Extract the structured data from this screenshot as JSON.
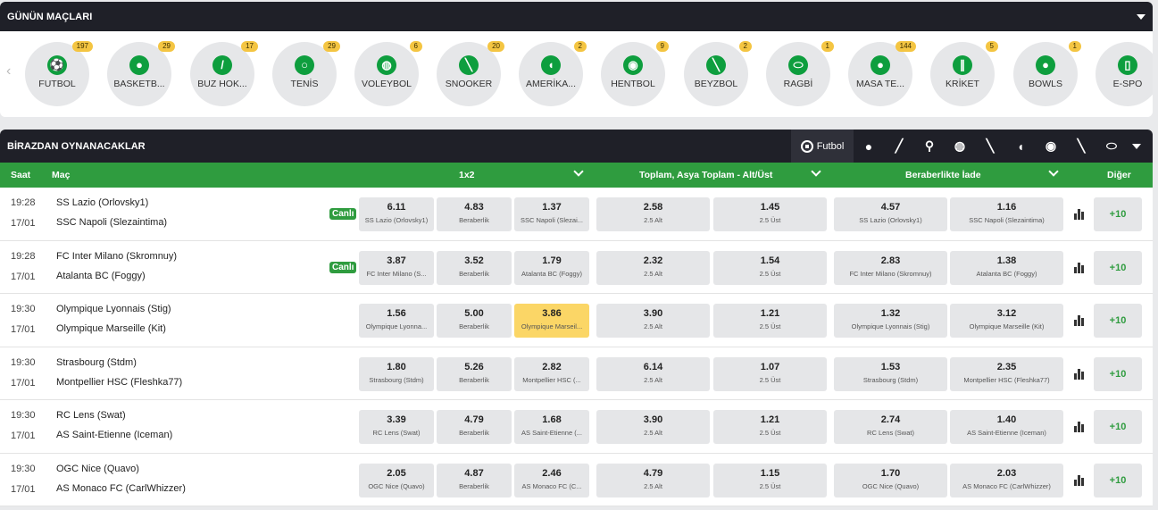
{
  "todays_matches": {
    "title": "GÜNÜN MAÇLARI",
    "sports": [
      {
        "name": "FUTBOL",
        "count": "197",
        "icon": "soccer-ball-icon",
        "glyph": "⚽"
      },
      {
        "name": "BASKETB...",
        "count": "29",
        "icon": "basketball-icon",
        "glyph": "●"
      },
      {
        "name": "BUZ HOK...",
        "count": "17",
        "icon": "ice-hockey-icon",
        "glyph": "/"
      },
      {
        "name": "TENİS",
        "count": "29",
        "icon": "tennis-icon",
        "glyph": "○"
      },
      {
        "name": "VOLEYBOL",
        "count": "6",
        "icon": "volleyball-icon",
        "glyph": "◍"
      },
      {
        "name": "SNOOKER",
        "count": "20",
        "icon": "snooker-icon",
        "glyph": "╲"
      },
      {
        "name": "AMERİKA...",
        "count": "2",
        "icon": "american-football-helmet-icon",
        "glyph": "◖"
      },
      {
        "name": "HENTBOL",
        "count": "9",
        "icon": "handball-icon",
        "glyph": "◉"
      },
      {
        "name": "BEYZBOL",
        "count": "2",
        "icon": "baseball-bat-icon",
        "glyph": "╲"
      },
      {
        "name": "RAGBİ",
        "count": "1",
        "icon": "rugby-ball-icon",
        "glyph": "⬭"
      },
      {
        "name": "MASA TE...",
        "count": "144",
        "icon": "table-tennis-icon",
        "glyph": "●"
      },
      {
        "name": "KRİKET",
        "count": "5",
        "icon": "cricket-icon",
        "glyph": "∥"
      },
      {
        "name": "BOWLS",
        "count": "1",
        "icon": "bowls-icon",
        "glyph": "●"
      },
      {
        "name": "E-SPO",
        "count": "",
        "icon": "esports-icon",
        "glyph": "▯"
      }
    ]
  },
  "upcoming": {
    "title": "BİRAZDAN OYNANACAKLAR",
    "active_filter": "Futbol",
    "filter_icons": [
      "basketball-icon",
      "ice-hockey-icon",
      "tennis-icon",
      "volleyball-icon",
      "snooker-icon",
      "american-football-helmet-icon",
      "handball-icon",
      "baseball-bat-icon",
      "rugby-ball-icon"
    ],
    "headers": {
      "time": "Saat",
      "match": "Maç",
      "market1": "1x2",
      "market2": "Toplam, Asya Toplam - Alt/Üst",
      "market3": "Beraberlikte İade",
      "other": "Diğer"
    },
    "rows": [
      {
        "time": "19:28",
        "date": "17/01",
        "home": "SS Lazio (Orlovsky1)",
        "away": "SSC Napoli (Slezaintima)",
        "live": "Canlı",
        "odds": [
          {
            "v": "6.11",
            "l": "SS Lazio (Orlovsky1)"
          },
          {
            "v": "4.83",
            "l": "Beraberlik"
          },
          {
            "v": "1.37",
            "l": "SSC Napoli (Slezai..."
          },
          {
            "v": "2.58",
            "l": "2.5 Alt"
          },
          {
            "v": "1.45",
            "l": "2.5 Üst"
          },
          {
            "v": "4.57",
            "l": "SS Lazio (Orlovsky1)"
          },
          {
            "v": "1.16",
            "l": "SSC Napoli (Slezaintima)"
          }
        ],
        "more": "+10",
        "highlight": -1
      },
      {
        "time": "19:28",
        "date": "17/01",
        "home": "FC Inter Milano (Skromnuy)",
        "away": "Atalanta BC (Foggy)",
        "live": "Canlı",
        "odds": [
          {
            "v": "3.87",
            "l": "FC Inter Milano (S..."
          },
          {
            "v": "3.52",
            "l": "Beraberlik"
          },
          {
            "v": "1.79",
            "l": "Atalanta BC (Foggy)"
          },
          {
            "v": "2.32",
            "l": "2.5 Alt"
          },
          {
            "v": "1.54",
            "l": "2.5 Üst"
          },
          {
            "v": "2.83",
            "l": "FC Inter Milano (Skromnuy)"
          },
          {
            "v": "1.38",
            "l": "Atalanta BC (Foggy)"
          }
        ],
        "more": "+10",
        "highlight": -1
      },
      {
        "time": "19:30",
        "date": "17/01",
        "home": "Olympique Lyonnais (Stig)",
        "away": "Olympique Marseille (Kit)",
        "live": "",
        "odds": [
          {
            "v": "1.56",
            "l": "Olympique Lyonna..."
          },
          {
            "v": "5.00",
            "l": "Beraberlik"
          },
          {
            "v": "3.86",
            "l": "Olympique Marseil..."
          },
          {
            "v": "3.90",
            "l": "2.5 Alt"
          },
          {
            "v": "1.21",
            "l": "2.5 Üst"
          },
          {
            "v": "1.32",
            "l": "Olympique Lyonnais (Stig)"
          },
          {
            "v": "3.12",
            "l": "Olympique Marseille (Kit)"
          }
        ],
        "more": "+10",
        "highlight": 2
      },
      {
        "time": "19:30",
        "date": "17/01",
        "home": "Strasbourg (Stdm)",
        "away": "Montpellier HSC (Fleshka77)",
        "live": "",
        "odds": [
          {
            "v": "1.80",
            "l": "Strasbourg (Stdm)"
          },
          {
            "v": "5.26",
            "l": "Beraberlik"
          },
          {
            "v": "2.82",
            "l": "Montpellier HSC (..."
          },
          {
            "v": "6.14",
            "l": "2.5 Alt"
          },
          {
            "v": "1.07",
            "l": "2.5 Üst"
          },
          {
            "v": "1.53",
            "l": "Strasbourg (Stdm)"
          },
          {
            "v": "2.35",
            "l": "Montpellier HSC (Fleshka77)"
          }
        ],
        "more": "+10",
        "highlight": -1
      },
      {
        "time": "19:30",
        "date": "17/01",
        "home": "RC Lens (Swat)",
        "away": "AS Saint-Etienne (Iceman)",
        "live": "",
        "odds": [
          {
            "v": "3.39",
            "l": "RC Lens (Swat)"
          },
          {
            "v": "4.79",
            "l": "Beraberlik"
          },
          {
            "v": "1.68",
            "l": "AS Saint-Etienne (..."
          },
          {
            "v": "3.90",
            "l": "2.5 Alt"
          },
          {
            "v": "1.21",
            "l": "2.5 Üst"
          },
          {
            "v": "2.74",
            "l": "RC Lens (Swat)"
          },
          {
            "v": "1.40",
            "l": "AS Saint-Etienne (Iceman)"
          }
        ],
        "more": "+10",
        "highlight": -1
      },
      {
        "time": "19:30",
        "date": "17/01",
        "home": "OGC Nice (Quavo)",
        "away": "AS Monaco FC (CarlWhizzer)",
        "live": "",
        "odds": [
          {
            "v": "2.05",
            "l": "OGC Nice (Quavo)"
          },
          {
            "v": "4.87",
            "l": "Beraberlik"
          },
          {
            "v": "2.46",
            "l": "AS Monaco FC (C..."
          },
          {
            "v": "4.79",
            "l": "2.5 Alt"
          },
          {
            "v": "1.15",
            "l": "2.5 Üst"
          },
          {
            "v": "1.70",
            "l": "OGC Nice (Quavo)"
          },
          {
            "v": "2.03",
            "l": "AS Monaco FC (CarlWhizzer)"
          }
        ],
        "more": "+10",
        "highlight": -1
      }
    ]
  },
  "colors": {
    "dark_bar": "#1f2028",
    "green": "#2f9c3f",
    "highlight": "#fbd666"
  }
}
